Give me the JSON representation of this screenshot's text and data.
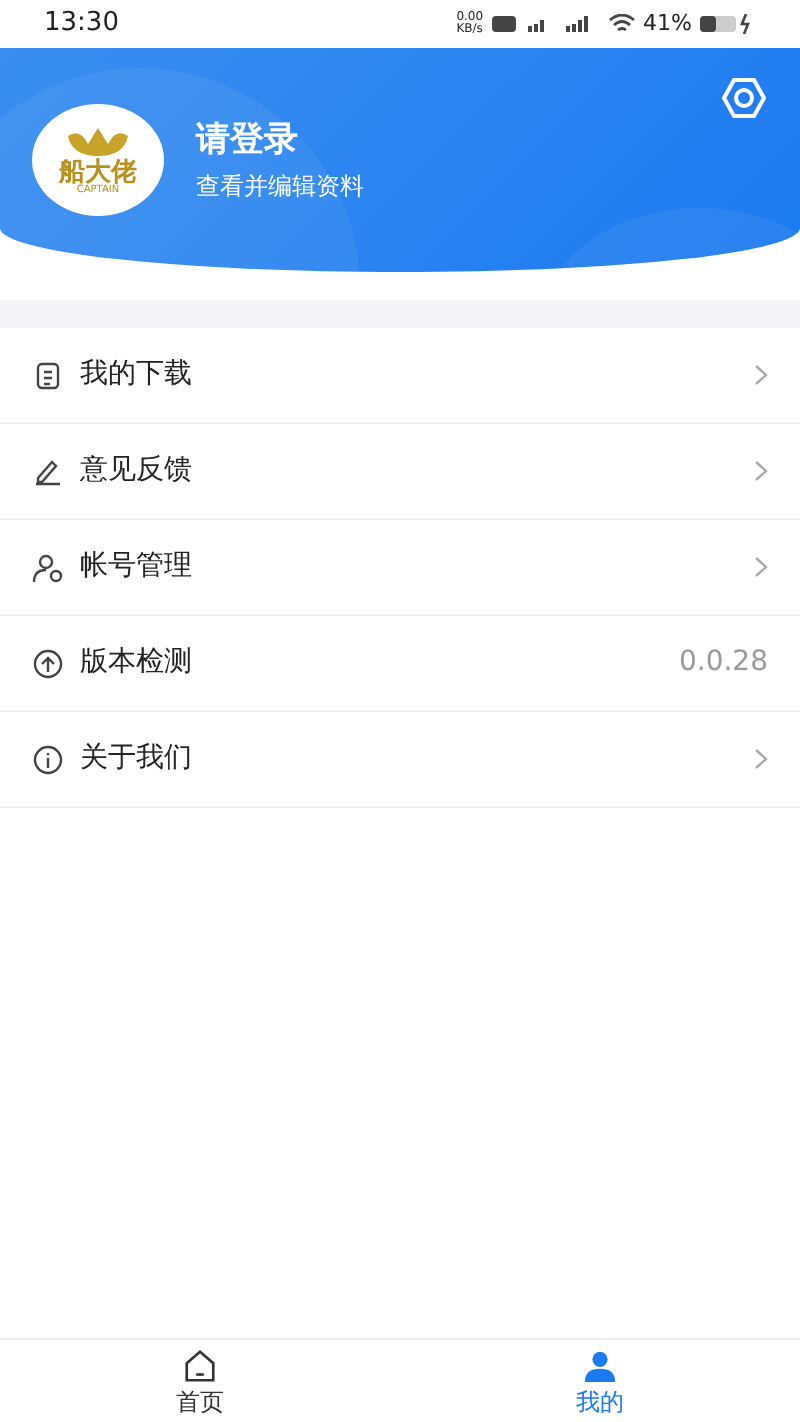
{
  "status_bar": {
    "time": "13:30",
    "speed": "0.00",
    "speed_unit": "KB/s",
    "battery": "41%"
  },
  "profile": {
    "logo_text": "船大佬",
    "logo_subtext": "CAPTAIN",
    "title": "请登录",
    "subtitle": "查看并编辑资料"
  },
  "menu": [
    {
      "label": "我的下载",
      "kind": "link"
    },
    {
      "label": "意见反馈",
      "kind": "link"
    },
    {
      "label": "帐号管理",
      "kind": "link"
    },
    {
      "label": "版本检测",
      "kind": "value",
      "value": "0.0.28"
    },
    {
      "label": "关于我们",
      "kind": "link"
    }
  ],
  "tabs": [
    {
      "label": "首页",
      "selected": false
    },
    {
      "label": "我的",
      "selected": true
    }
  ]
}
